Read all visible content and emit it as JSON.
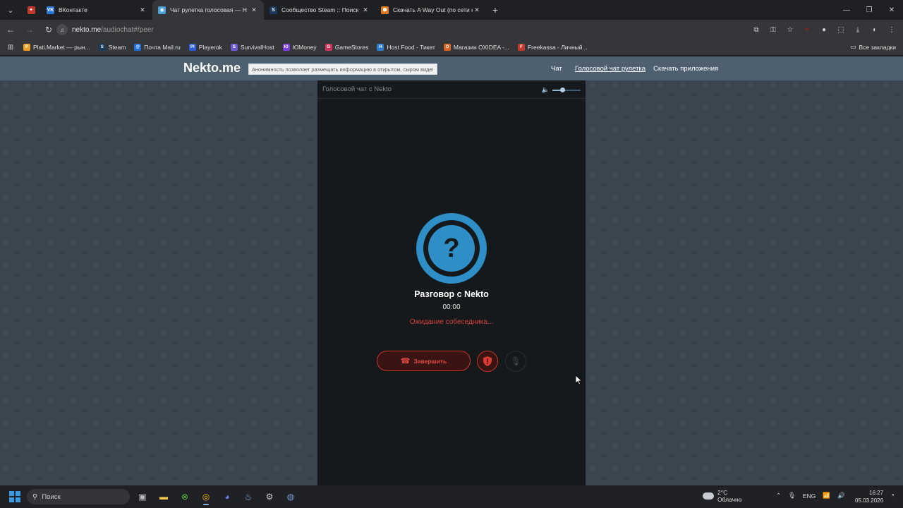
{
  "browser": {
    "tabs": [
      {
        "title": "",
        "icon": "vk-red-icon",
        "pinned": true
      },
      {
        "title": "ВКонтакте",
        "icon": "vk-icon"
      },
      {
        "title": "Чат рулетка голосовая — Н",
        "icon": "nekto-icon",
        "active": true
      },
      {
        "title": "Сообщество Steam :: Поиск",
        "icon": "steam-icon"
      },
      {
        "title": "Скачать A Way Out (по сети на",
        "icon": "game-icon"
      }
    ],
    "url": {
      "host": "nekto.me",
      "path": "/audiochat#/peer"
    },
    "bookmarks": [
      {
        "label": "Plati.Market — рын...",
        "color": "#f0a020",
        "glyph": "P"
      },
      {
        "label": "Steam",
        "color": "#1b3a5c",
        "glyph": "S"
      },
      {
        "label": "Почта Mail.ru",
        "color": "#1f6ed4",
        "glyph": "@"
      },
      {
        "label": "Playerok",
        "color": "#2f5bd6",
        "glyph": "Pl"
      },
      {
        "label": "SurvivalHost",
        "color": "#6a5acd",
        "glyph": "S"
      },
      {
        "label": "ЮMoney",
        "color": "#7b3fe4",
        "glyph": "Ю"
      },
      {
        "label": "GameStores",
        "color": "#d4345c",
        "glyph": "G"
      },
      {
        "label": "Host Food - Тикет",
        "color": "#2d7fd0",
        "glyph": "H"
      },
      {
        "label": "Магазин OXIDEA -...",
        "color": "#d9641f",
        "glyph": "O"
      },
      {
        "label": "Freekassa - Личный...",
        "color": "#c0392b",
        "glyph": "F"
      }
    ],
    "all_bookmarks": "Все закладки"
  },
  "site": {
    "logo": "Nekto.me",
    "notice": "Анонимность позволяет размещать информацию в открытом, сыром виде!",
    "nav": [
      {
        "label": "Чат",
        "active": false
      },
      {
        "label": "Голосовой чат рулетка",
        "active": true
      },
      {
        "label": "Скачать приложения",
        "active": false
      }
    ]
  },
  "call": {
    "panel_title": "Голосовой чат с Nekto",
    "volume": 0.35,
    "avatar_glyph": "?",
    "title": "Разговор с Nekto",
    "timer": "00:00",
    "status": "Ожидание собеседника...",
    "end_label": "Завершить"
  },
  "taskbar": {
    "search_placeholder": "Поиск",
    "weather_temp": "2°C",
    "weather_desc": "Облачно",
    "lang": "ENG",
    "time": "16:27",
    "date": "05.03.2026"
  },
  "colors": {
    "accent_blue": "#2d8fc6",
    "danger_red": "#d2403b",
    "header": "#4e6070"
  }
}
